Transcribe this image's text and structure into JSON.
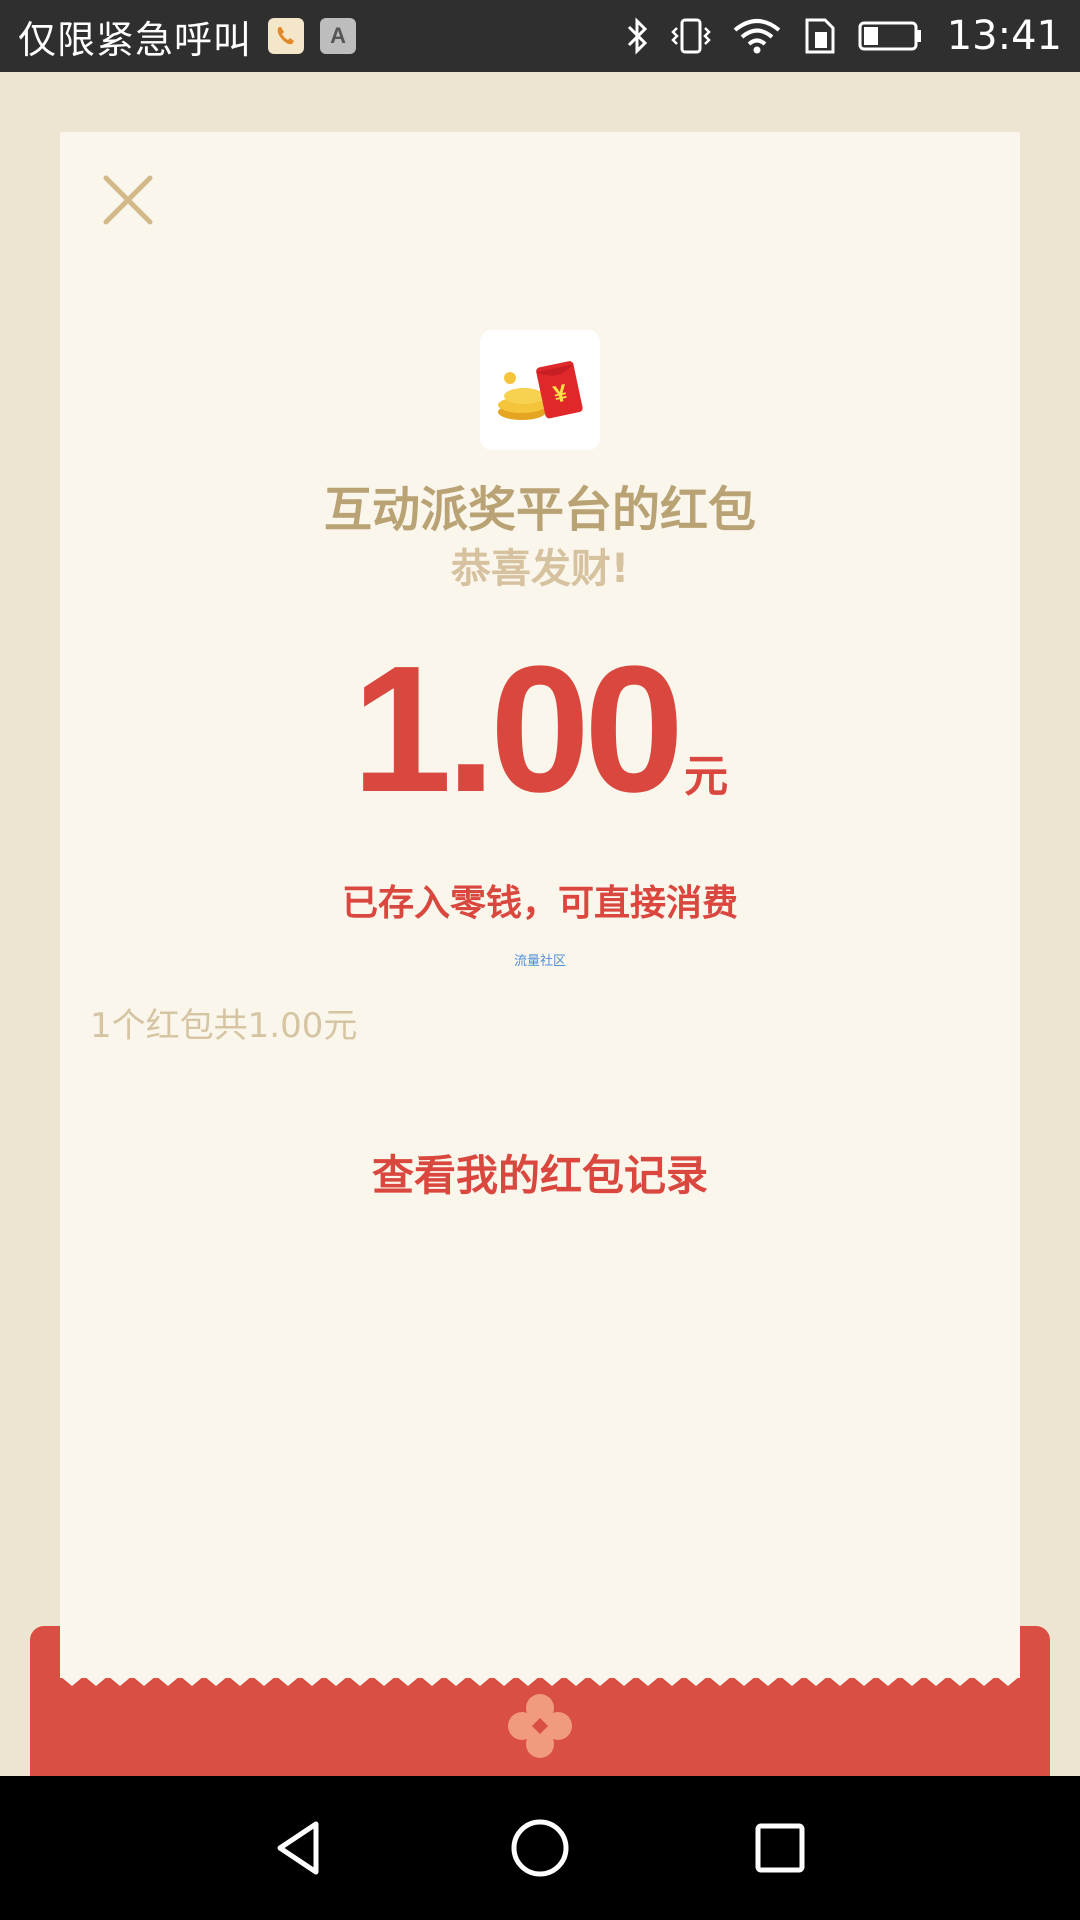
{
  "status_bar": {
    "carrier_text": "仅限紧急呼叫",
    "time": "13:41",
    "app_icon_a": "A",
    "icons": [
      "phone-app-icon",
      "keyboard-a-icon",
      "bluetooth-icon",
      "vibrate-icon",
      "wifi-icon",
      "sim-icon",
      "battery-icon"
    ]
  },
  "card": {
    "title": "互动派奖平台的红包",
    "subtitle": "恭喜发财!",
    "amount": "1.00",
    "unit": "元",
    "note": "已存入零钱，可直接消费",
    "source_link": "流量社区",
    "summary": "1个红包共1.00元",
    "records_link": "查看我的红包记录"
  },
  "colors": {
    "accent_red": "#D9473E",
    "gold_text": "#B9A274",
    "card_bg": "#FAF6EC",
    "page_bg": "#EDE5D1",
    "envelope_red": "#D94F44"
  }
}
